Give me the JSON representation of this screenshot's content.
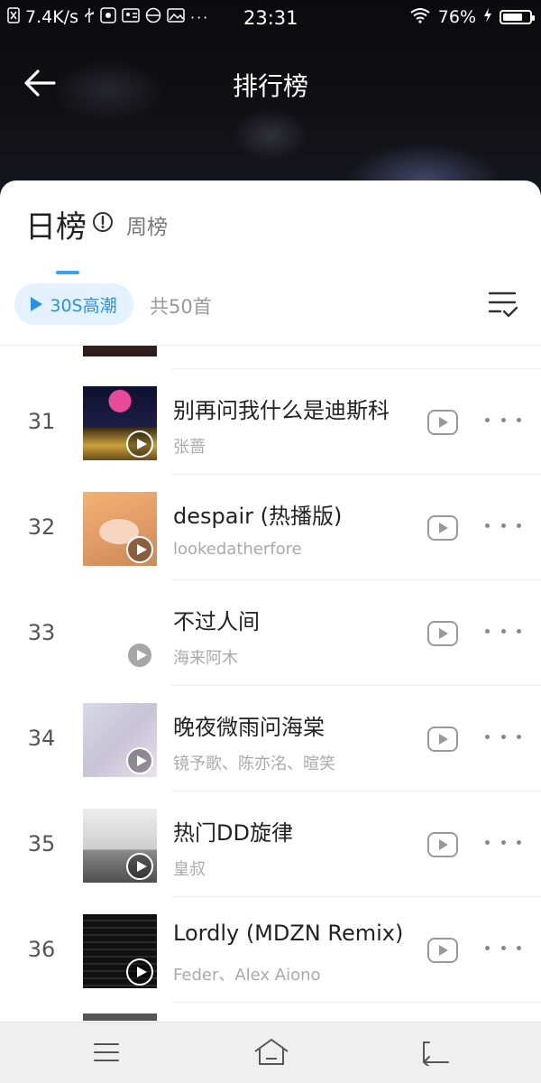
{
  "status_bar": {
    "net_speed": "7.4K/s",
    "time": "23:31",
    "battery": "76%",
    "battery_level": 0.76
  },
  "nav": {
    "title": "排行榜"
  },
  "tabs": {
    "daily": "日榜",
    "weekly": "周榜"
  },
  "toolbar": {
    "chip_label": "30S高潮",
    "count_label": "共50首"
  },
  "songs": [
    {
      "rank": "31",
      "title": "别再问我什么是迪斯科",
      "artist": "张蔷"
    },
    {
      "rank": "32",
      "title": "despair (热播版)",
      "artist": "lookedatherfore"
    },
    {
      "rank": "33",
      "title": "不过人间",
      "artist": "海来阿木"
    },
    {
      "rank": "34",
      "title": "晚夜微雨问海棠",
      "artist": "镜予歌、陈亦洺、暄笑"
    },
    {
      "rank": "35",
      "title": "热门DD旋律",
      "artist": "皇叔"
    },
    {
      "rank": "36",
      "title": "Lordly (MDZN Remix)",
      "artist": "Feder、Alex Aiono"
    }
  ]
}
